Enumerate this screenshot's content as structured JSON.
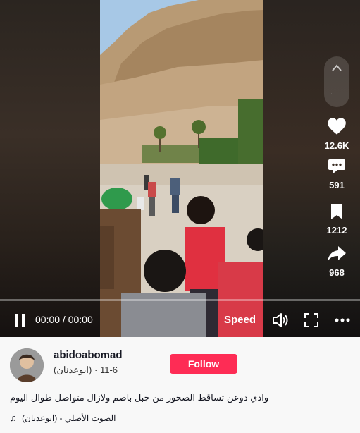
{
  "player": {
    "time": "00:00 / 00:00",
    "speed_label": "Speed",
    "progress": 0.0
  },
  "actions": {
    "likes": "12.6K",
    "comments": "591",
    "saves": "1212",
    "shares": "968"
  },
  "author": {
    "username": "abidoabomad",
    "display_name": "(ابوعدنان)",
    "date": "6-11",
    "separator": "·"
  },
  "follow_label": "Follow",
  "caption": "وادي دوعن تساقط الصخور من جبل باصم ولازال متواصل طوال اليوم",
  "music": {
    "title": "الصوت الأصلي - (ابوعدنان)"
  },
  "colors": {
    "accent": "#fe2c55",
    "info_bg": "#f8f8f8",
    "text": "#161823"
  },
  "icons": [
    "chevron-up-icon",
    "heart-icon",
    "comment-icon",
    "bookmark-icon",
    "share-icon",
    "pause-icon",
    "volume-icon",
    "fullscreen-icon",
    "more-icon",
    "music-note-icon"
  ]
}
